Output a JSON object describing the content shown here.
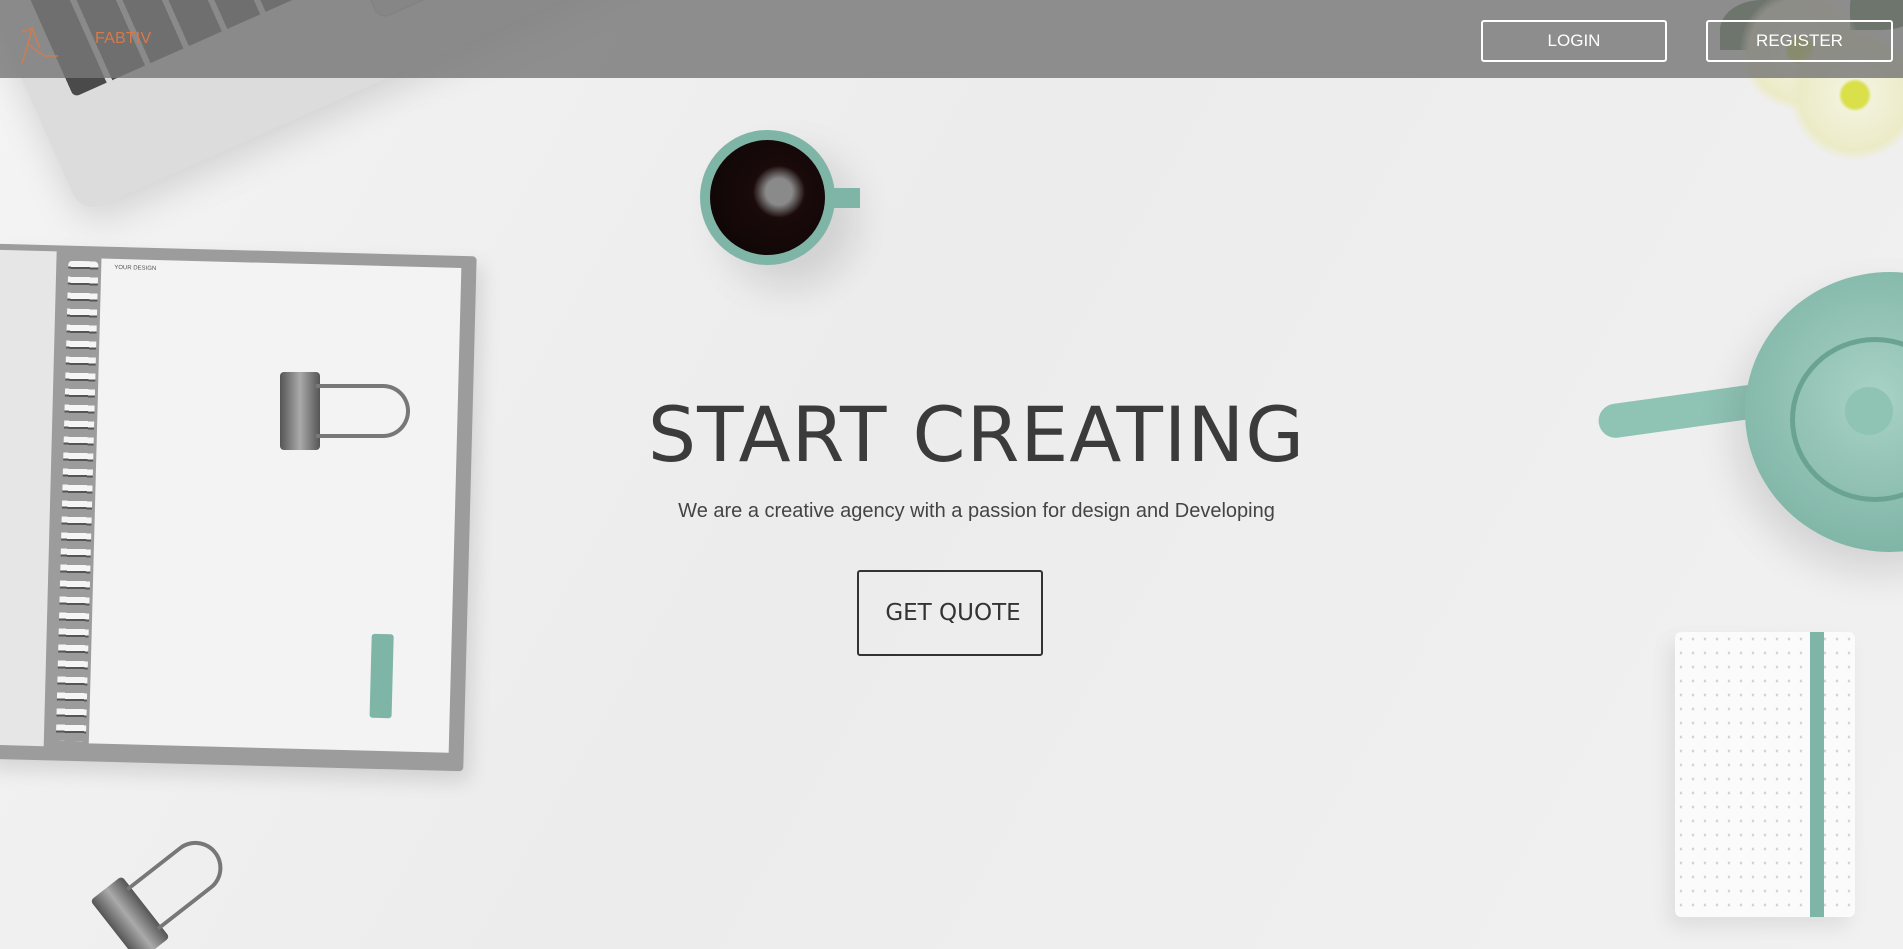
{
  "header": {
    "brand": "FABTIV",
    "login_label": "LOGIN",
    "register_label": "REGISTER"
  },
  "hero": {
    "headline": "START CREATING",
    "subtitle": "We are a creative agency with a passion for design and Developing",
    "cta_label": "GET QUOTE"
  },
  "decor": {
    "notebook_label": "YOUR DESIGN"
  },
  "colors": {
    "brand": "#d77a4a",
    "accent_mint": "#7fb5a6",
    "header_bg": "#787878",
    "text_dark": "#3b3b3b"
  }
}
